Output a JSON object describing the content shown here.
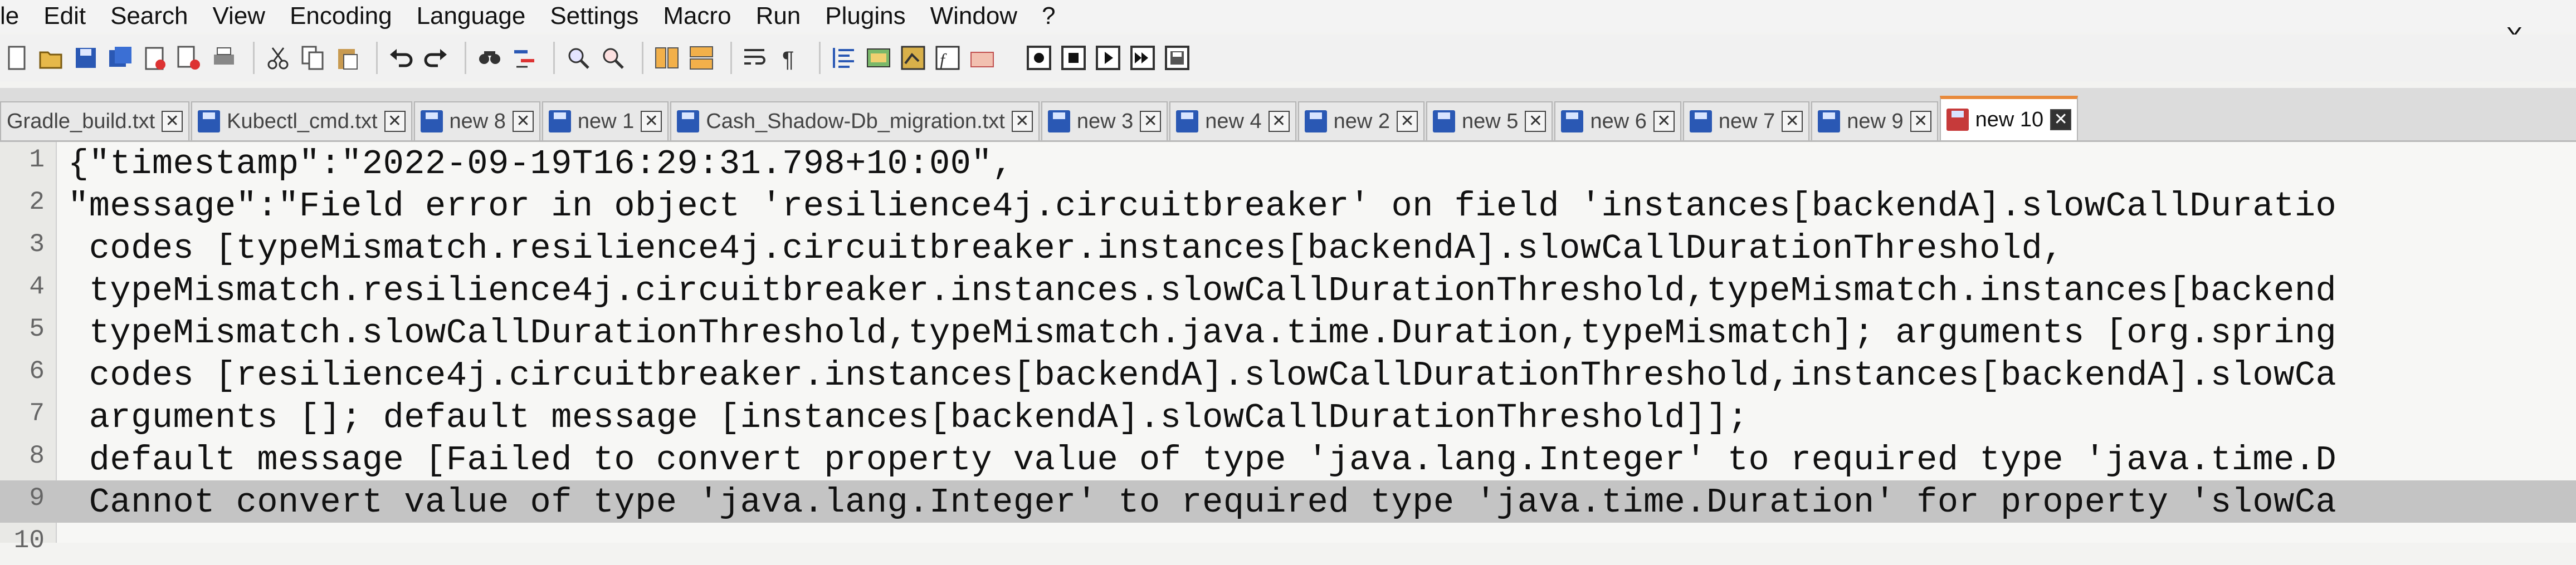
{
  "menu": [
    "le",
    "Edit",
    "Search",
    "View",
    "Encoding",
    "Language",
    "Settings",
    "Macro",
    "Run",
    "Plugins",
    "Window",
    "?"
  ],
  "window": {
    "close_glyph": "X"
  },
  "toolbar": {
    "icons": [
      "new-file-icon",
      "open-file-icon",
      "save-icon",
      "save-all-icon",
      "close-icon",
      "close-all-icon",
      "print-icon",
      "cut-icon",
      "copy-icon",
      "paste-icon",
      "undo-icon",
      "redo-icon",
      "find-icon",
      "replace-icon",
      "zoom-in-icon",
      "zoom-out-icon",
      "sync-vertical-icon",
      "sync-horizontal-icon",
      "word-wrap-icon",
      "show-all-chars-icon",
      "indent-guide-icon",
      "language-icon",
      "doc-map-icon",
      "function-list-icon",
      "folder-workspace-icon",
      "record-macro-icon",
      "stop-macro-icon",
      "play-macro-icon",
      "run-macro-multiple-icon",
      "save-macro-icon"
    ]
  },
  "tabs": [
    {
      "label": "Gradle_build.txt",
      "active": false
    },
    {
      "label": "Kubectl_cmd.txt",
      "active": false
    },
    {
      "label": "new 8",
      "active": false
    },
    {
      "label": "new 1",
      "active": false
    },
    {
      "label": "Cash_Shadow-Db_migration.txt",
      "active": false
    },
    {
      "label": "new 3",
      "active": false
    },
    {
      "label": "new 4",
      "active": false
    },
    {
      "label": "new 2",
      "active": false
    },
    {
      "label": "new 5",
      "active": false
    },
    {
      "label": "new 6",
      "active": false
    },
    {
      "label": "new 7",
      "active": false
    },
    {
      "label": "new 9",
      "active": false
    },
    {
      "label": "new 10",
      "active": true
    }
  ],
  "tab_close_glyph": "✕",
  "editor": {
    "current_line": 9,
    "lines": [
      {
        "num": "1",
        "text": "{\"timestamp\":\"2022-09-19T16:29:31.798+10:00\","
      },
      {
        "num": "2",
        "text": "\"message\":\"Field error in object 'resilience4j.circuitbreaker' on field 'instances[backendA].slowCallDuratio"
      },
      {
        "num": "3",
        "text": " codes [typeMismatch.resilience4j.circuitbreaker.instances[backendA].slowCallDurationThreshold,"
      },
      {
        "num": "4",
        "text": " typeMismatch.resilience4j.circuitbreaker.instances.slowCallDurationThreshold,typeMismatch.instances[backend"
      },
      {
        "num": "5",
        "text": " typeMismatch.slowCallDurationThreshold,typeMismatch.java.time.Duration,typeMismatch]; arguments [org.spring"
      },
      {
        "num": "6",
        "text": " codes [resilience4j.circuitbreaker.instances[backendA].slowCallDurationThreshold,instances[backendA].slowCa"
      },
      {
        "num": "7",
        "text": " arguments []; default message [instances[backendA].slowCallDurationThreshold]];"
      },
      {
        "num": "8",
        "text": " default message [Failed to convert property value of type 'java.lang.Integer' to required type 'java.time.D"
      },
      {
        "num": "9",
        "text": " Cannot convert value of type 'java.lang.Integer' to required type 'java.time.Duration' for property 'slowCa"
      },
      {
        "num": "10",
        "text": ""
      }
    ]
  }
}
